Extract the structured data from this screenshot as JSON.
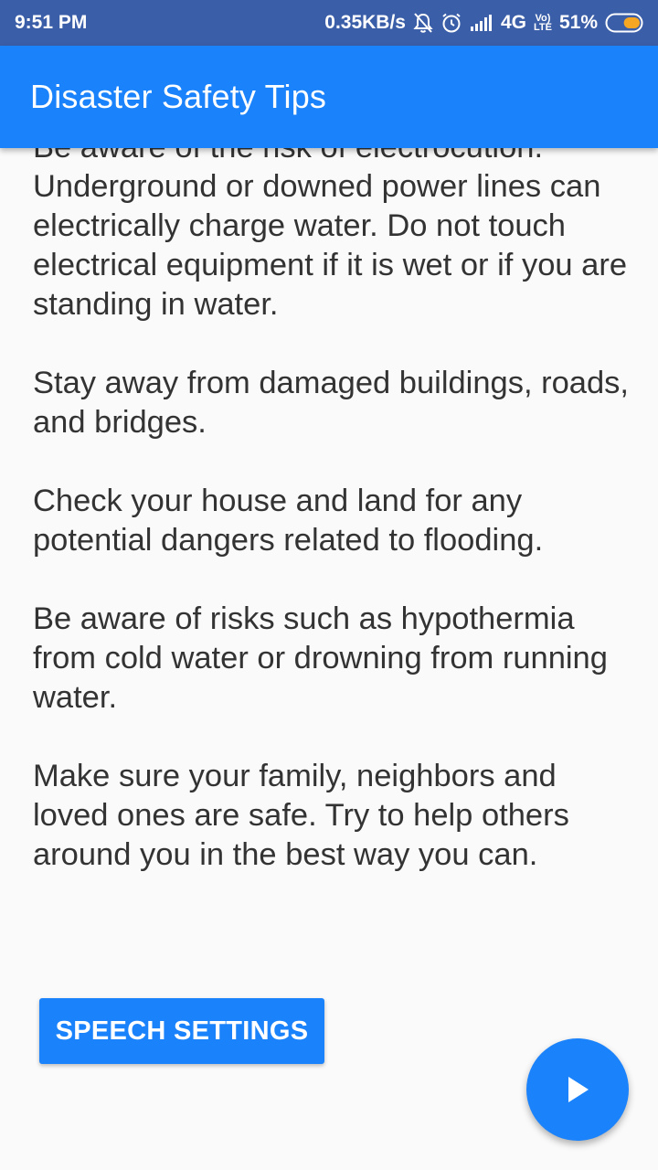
{
  "status_bar": {
    "time": "9:51 PM",
    "net_speed": "0.35KB/s",
    "network": "4G",
    "volte_top": "Vo)",
    "volte_bottom": "LTE",
    "battery": "51%",
    "battery_level": 0.51,
    "icons": [
      "alarm-muted-icon",
      "alarm-clock-icon",
      "signal-icon",
      "battery-icon"
    ]
  },
  "app_bar": {
    "title": "Disaster Safety Tips"
  },
  "tips": [
    "Be aware of the risk of electrocution. Underground or downed power lines can electrically charge water. Do not touch electrical equipment if it is wet or if you are standing in water.",
    "Stay away from damaged buildings, roads, and bridges.",
    "Check your house and land for any potential dangers related to flooding.",
    "Be aware of risks such as hypothermia from cold water or drowning from running water.",
    "Make sure your family, neighbors and loved ones are safe. Try to help others around you in the best way you can."
  ],
  "buttons": {
    "speech_settings": "SPEECH SETTINGS",
    "play_icon": "play-icon"
  },
  "colors": {
    "status_bar": "#3b5ea8",
    "primary": "#1a82fb",
    "text": "#333333",
    "background": "#fafafa",
    "battery_fill": "#f5a623"
  }
}
